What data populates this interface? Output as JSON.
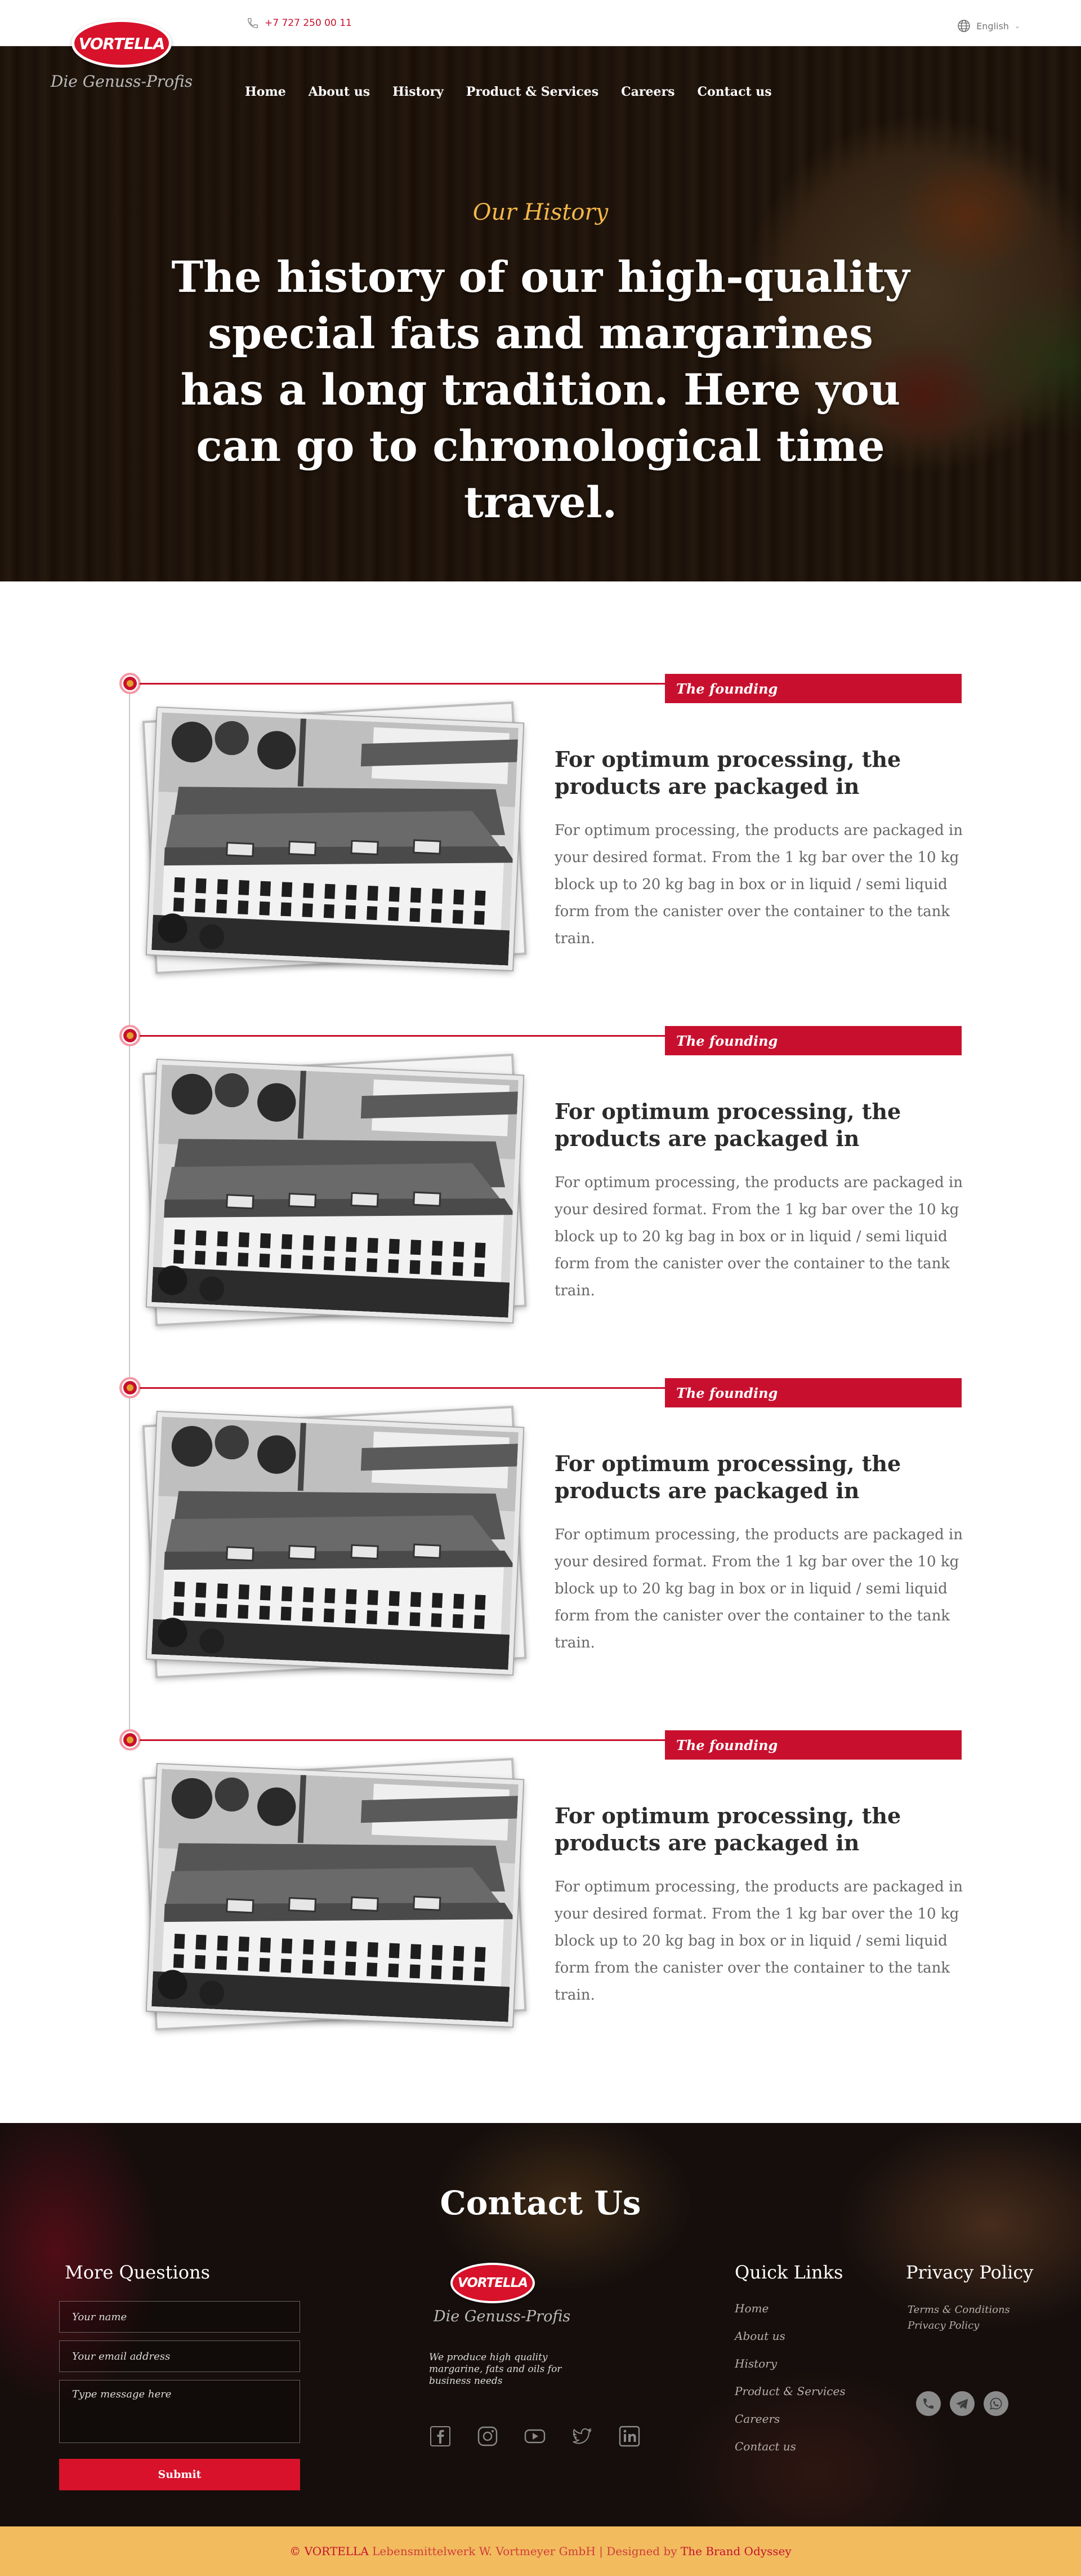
{
  "header": {
    "phone": "+7 727 250 00 11",
    "language": "English",
    "logo_text": "VORTELLA",
    "logo_tagline": "Die Genuss-Profis"
  },
  "nav": [
    {
      "label": "Home"
    },
    {
      "label": "About us"
    },
    {
      "label": "History"
    },
    {
      "label": "Product & Services"
    },
    {
      "label": "Careers"
    },
    {
      "label": "Contact us"
    }
  ],
  "hero": {
    "subtitle": "Our History",
    "title": "The history of our high-quality special fats and margarines has a long tradition. Here you can go to chronological time travel."
  },
  "timeline": [
    {
      "badge": "The founding",
      "heading": "For optimum processing, the products are packaged in",
      "body": "For optimum processing, the products are packaged in your desired format. From the 1 kg bar over the 10 kg block up to 20 kg bag in box or in liquid / semi liquid form from the canister over the container to the tank train."
    },
    {
      "badge": "The founding",
      "heading": "For optimum processing, the products are packaged in",
      "body": "For optimum processing, the products are packaged in your desired format. From the 1 kg bar over the 10 kg block up to 20 kg bag in box or in liquid / semi liquid form from the canister over the container to the tank train."
    },
    {
      "badge": "The founding",
      "heading": "For optimum processing, the products are packaged in",
      "body": "For optimum processing, the products are packaged in your desired format. From the 1 kg bar over the 10 kg block up to 20 kg bag in box or in liquid / semi liquid form from the canister over the container to the tank train."
    },
    {
      "badge": "The founding",
      "heading": "For optimum processing, the products are packaged in",
      "body": "For optimum processing, the products are packaged in your desired format. From the 1 kg bar over the 10 kg block up to 20 kg bag in box or in liquid / semi liquid form from the canister over the container to the tank train."
    }
  ],
  "contact": {
    "title": "Contact Us",
    "questions_title": "More Questions",
    "name_placeholder": "Your name",
    "email_placeholder": "Your email address",
    "message_placeholder": "Type message here",
    "submit_label": "Submit",
    "footer_logo_text": "VORTELLA",
    "footer_tagline": "Die Genuss-Profis",
    "description": "We produce high quality margarine, fats and oils for business needs",
    "quick_links_title": "Quick Links",
    "quick_links": [
      "Home",
      "About us",
      "History",
      "Product & Services",
      "Careers",
      "Contact us"
    ],
    "privacy_title": "Privacy Policy",
    "privacy_links": [
      "Terms & Conditions",
      "Privacy Policy"
    ],
    "socials": [
      "facebook-icon",
      "instagram-icon",
      "youtube-icon",
      "twitter-icon",
      "linkedin-icon"
    ],
    "contact_icons": [
      "phone-icon",
      "telegram-icon",
      "whatsapp-icon"
    ]
  },
  "footer": {
    "copyright": "© VORTELLA",
    "company": "Lebensmittelwerk W. Vortmeyer GmbH",
    "separator": "|",
    "designed_by_label": "Designed by",
    "designer": "The Brand Odyssey"
  },
  "colors": {
    "brand_red": "#c8102e",
    "accent_gold": "#f3b84a",
    "footer_bar": "#f1bb5e"
  }
}
